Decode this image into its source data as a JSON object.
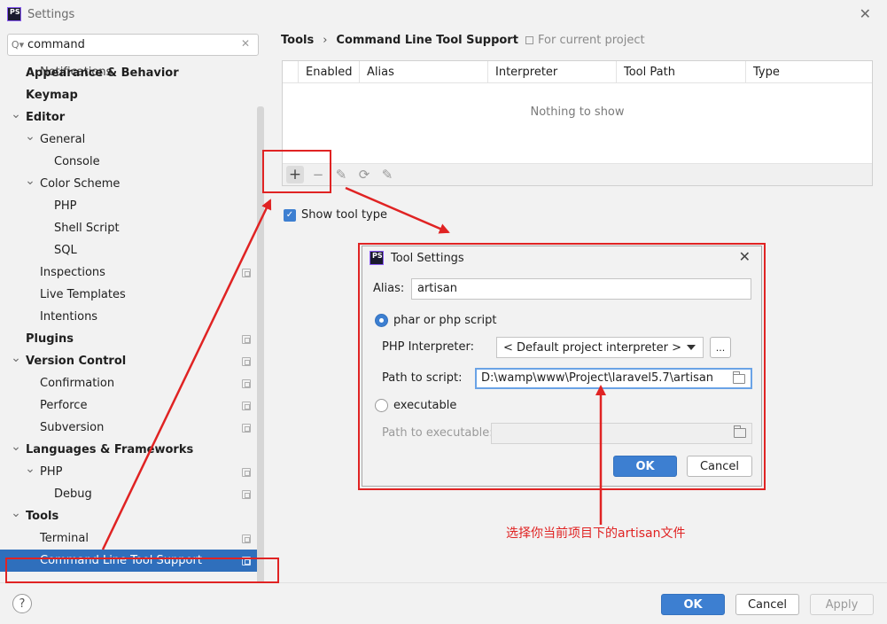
{
  "window": {
    "title": "Settings",
    "logo_text": "PS"
  },
  "search": {
    "value": "command"
  },
  "sidebar": {
    "ghost_item": "Notifications",
    "items": [
      {
        "label": "Appearance & Behavior",
        "level": 0,
        "bold": true,
        "chevron": "",
        "project_icon": false
      },
      {
        "label": "Keymap",
        "level": 0,
        "bold": true,
        "chevron": "",
        "project_icon": false
      },
      {
        "label": "Editor",
        "level": 0,
        "bold": true,
        "chevron": "expanded",
        "project_icon": false
      },
      {
        "label": "General",
        "level": 1,
        "bold": false,
        "chevron": "expanded",
        "project_icon": false
      },
      {
        "label": "Console",
        "level": 2,
        "bold": false,
        "chevron": "",
        "project_icon": false
      },
      {
        "label": "Color Scheme",
        "level": 1,
        "bold": false,
        "chevron": "expanded",
        "project_icon": false
      },
      {
        "label": "PHP",
        "level": 2,
        "bold": false,
        "chevron": "",
        "project_icon": false
      },
      {
        "label": "Shell Script",
        "level": 2,
        "bold": false,
        "chevron": "",
        "project_icon": false
      },
      {
        "label": "SQL",
        "level": 2,
        "bold": false,
        "chevron": "",
        "project_icon": false
      },
      {
        "label": "Inspections",
        "level": 1,
        "bold": false,
        "chevron": "",
        "project_icon": true
      },
      {
        "label": "Live Templates",
        "level": 1,
        "bold": false,
        "chevron": "",
        "project_icon": false
      },
      {
        "label": "Intentions",
        "level": 1,
        "bold": false,
        "chevron": "",
        "project_icon": false
      },
      {
        "label": "Plugins",
        "level": 0,
        "bold": true,
        "chevron": "",
        "project_icon": true
      },
      {
        "label": "Version Control",
        "level": 0,
        "bold": true,
        "chevron": "expanded",
        "project_icon": true
      },
      {
        "label": "Confirmation",
        "level": 1,
        "bold": false,
        "chevron": "",
        "project_icon": true
      },
      {
        "label": "Perforce",
        "level": 1,
        "bold": false,
        "chevron": "",
        "project_icon": true
      },
      {
        "label": "Subversion",
        "level": 1,
        "bold": false,
        "chevron": "",
        "project_icon": true
      },
      {
        "label": "Languages & Frameworks",
        "level": 0,
        "bold": true,
        "chevron": "expanded",
        "project_icon": false
      },
      {
        "label": "PHP",
        "level": 1,
        "bold": false,
        "chevron": "expanded",
        "project_icon": true
      },
      {
        "label": "Debug",
        "level": 2,
        "bold": false,
        "chevron": "",
        "project_icon": true
      },
      {
        "label": "Tools",
        "level": 0,
        "bold": true,
        "chevron": "expanded",
        "project_icon": false
      },
      {
        "label": "Terminal",
        "level": 1,
        "bold": false,
        "chevron": "",
        "project_icon": true
      },
      {
        "label": "Command Line Tool Support",
        "level": 1,
        "bold": false,
        "chevron": "",
        "project_icon": true,
        "selected": true
      }
    ]
  },
  "breadcrumb": {
    "parent": "Tools",
    "separator": "›",
    "current": "Command Line Tool Support"
  },
  "for_project": "For current project",
  "table": {
    "columns": [
      "Enabled",
      "Alias",
      "Interpreter",
      "Tool Path",
      "Type"
    ],
    "empty_text": "Nothing to show"
  },
  "toolbar": {
    "add": "+",
    "remove": "−",
    "edit": "✎",
    "reload": "⟳",
    "export": "✎"
  },
  "show_tool_type": {
    "label": "Show tool type",
    "checked": true
  },
  "dialog": {
    "title": "Tool Settings",
    "alias_label": "Alias:",
    "alias_value": "artisan",
    "radio_php": "phar or php script",
    "php_interpreter_label": "PHP Interpreter:",
    "php_interpreter_value": "< Default project interpreter >",
    "dots": "...",
    "path_script_label": "Path to script:",
    "path_script_value": "D:\\wamp\\www\\Project\\laravel5.7\\artisan",
    "radio_exec": "executable",
    "path_exec_label": "Path to executable:",
    "ok": "OK",
    "cancel": "Cancel"
  },
  "annotation": "选择你当前项目下的artisan文件",
  "footer": {
    "help": "?",
    "ok": "OK",
    "cancel": "Cancel",
    "apply": "Apply"
  },
  "colors": {
    "accent": "#3d7fd1",
    "selection": "#2f6fbc",
    "annotation_red": "#e02323"
  }
}
